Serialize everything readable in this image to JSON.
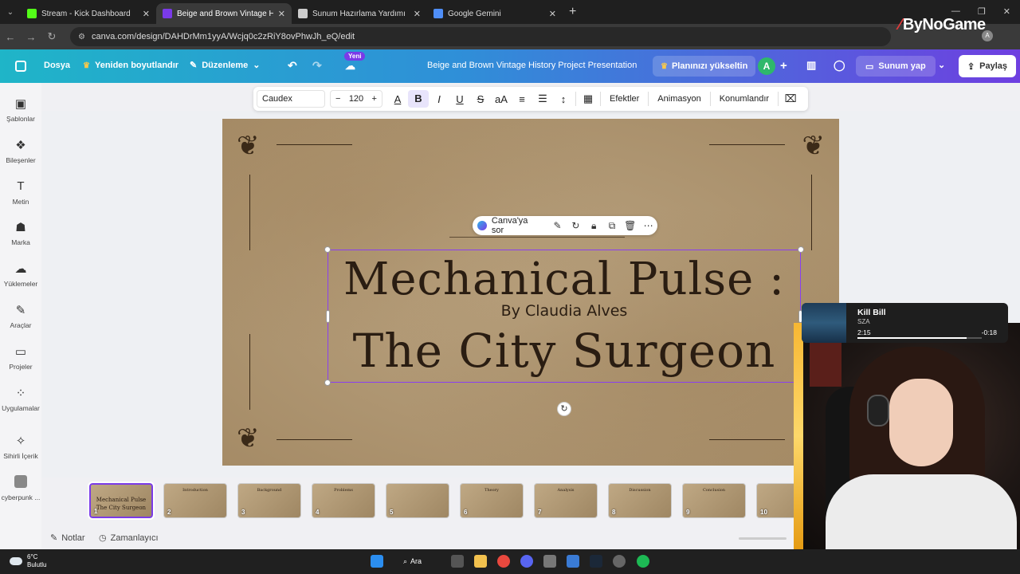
{
  "browser": {
    "tabs": [
      {
        "title": "Stream - Kick Dashboard",
        "color": "#53fc18",
        "active": false
      },
      {
        "title": "Beige and Brown Vintage History Project Presentation",
        "color": "#7a3ae8",
        "active": true
      },
      {
        "title": "Sunum Hazırlama Yardımı",
        "color": "#cccccc",
        "active": false
      },
      {
        "title": "Google Gemini",
        "color": "#4f8ef7",
        "active": false
      }
    ],
    "url": "canva.com/design/DAHDrMm1yyA/Wcjq0c2zRiY8ovPhwJh_eQ/edit",
    "overlay_brand": "ByNoGame",
    "profile_initial": "A"
  },
  "canva_header": {
    "file_label": "Dosya",
    "resize_label": "Yeniden boyutlandır",
    "edit_label": "Düzenleme",
    "new_badge": "Yeni",
    "doc_title": "Beige and Brown Vintage History Project Presentation",
    "upgrade_label": "Planınızı yükseltin",
    "user_initial": "A",
    "present_label": "Sunum yap",
    "share_label": "Paylaş"
  },
  "sidebar": {
    "items": [
      {
        "label": "Şablonlar",
        "icon": "templates-icon"
      },
      {
        "label": "Bileşenler",
        "icon": "elements-icon"
      },
      {
        "label": "Metin",
        "icon": "text-icon"
      },
      {
        "label": "Marka",
        "icon": "brand-icon"
      },
      {
        "label": "Yüklemeler",
        "icon": "uploads-icon"
      },
      {
        "label": "Araçlar",
        "icon": "draw-icon"
      },
      {
        "label": "Projeler",
        "icon": "folder-icon"
      },
      {
        "label": "Uygulamalar",
        "icon": "apps-icon"
      },
      {
        "label": "Sihirli İçerik",
        "icon": "magic-icon"
      },
      {
        "label": "cyberpunk ...",
        "icon": "cyberpunk-icon"
      }
    ]
  },
  "toolbar": {
    "font": "Caudex",
    "size": "120",
    "effects_label": "Efektler",
    "animation_label": "Animasyon",
    "position_label": "Konumlandır"
  },
  "context_menu": {
    "ask_label": "Canva'ya sor"
  },
  "slide": {
    "title_line1": "Mechanical Pulse :",
    "byline": "By Claudia Alves",
    "title_line2": "The City Surgeon"
  },
  "thumbnails": [
    {
      "num": "1",
      "caption": "Mechanical Pulse\nThe City Surgeon",
      "active": true
    },
    {
      "num": "2",
      "caption": "Introduction",
      "active": false
    },
    {
      "num": "3",
      "caption": "Background",
      "active": false
    },
    {
      "num": "4",
      "caption": "Problems",
      "active": false
    },
    {
      "num": "5",
      "caption": "",
      "active": false
    },
    {
      "num": "6",
      "caption": "Theory",
      "active": false
    },
    {
      "num": "7",
      "caption": "Analysis",
      "active": false
    },
    {
      "num": "8",
      "caption": "Discussion",
      "active": false
    },
    {
      "num": "9",
      "caption": "Conclusion",
      "active": false
    },
    {
      "num": "10",
      "caption": "",
      "active": false
    }
  ],
  "bottom": {
    "notes_label": "Notlar",
    "timer_label": "Zamanlayıcı"
  },
  "taskbar": {
    "temperature": "6°C",
    "weather": "Bulutlu",
    "search_label": "Ara"
  },
  "music": {
    "song": "Kill Bill",
    "artist": "SZA",
    "elapsed": "2:15",
    "remaining": "-0:18",
    "progress": 0.88
  }
}
